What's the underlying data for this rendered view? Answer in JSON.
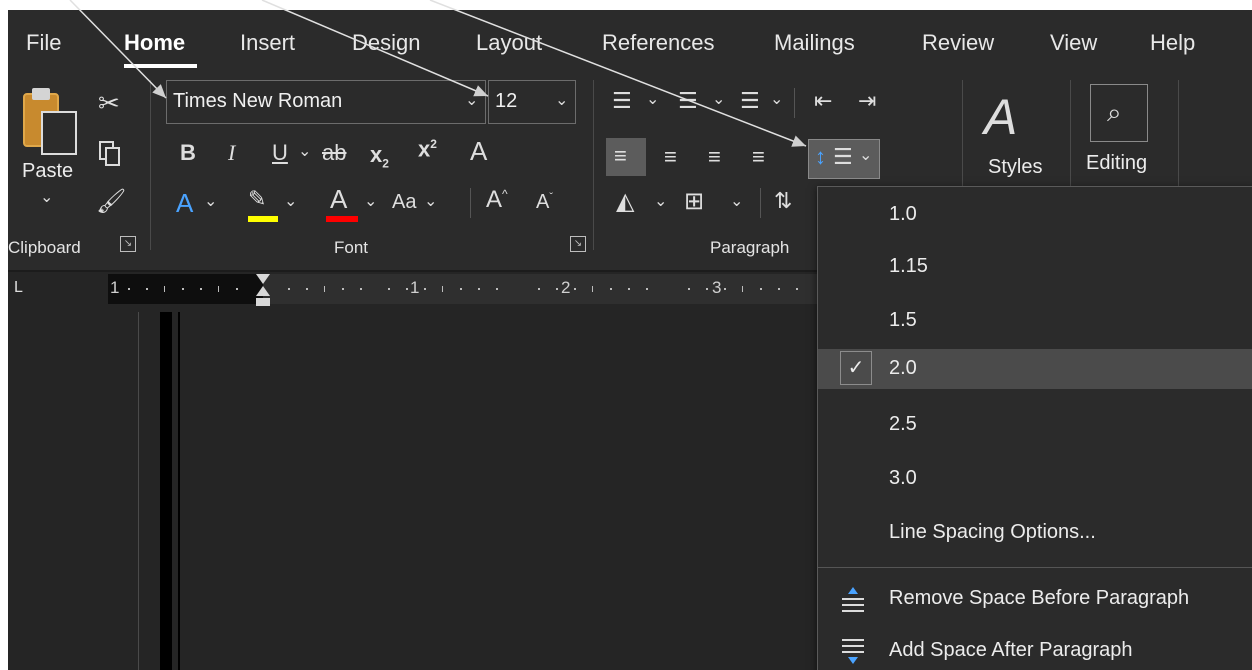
{
  "menu": {
    "tabs": [
      "File",
      "Home",
      "Insert",
      "Design",
      "Layout",
      "References",
      "Mailings",
      "Review",
      "View",
      "Help"
    ],
    "active": "Home"
  },
  "clipboard": {
    "paste_label": "Paste",
    "group_label": "Clipboard"
  },
  "font": {
    "name": "Times New Roman",
    "size": "12",
    "group_label": "Font",
    "change_case_label": "Aa",
    "highlight_color": "#ffff00",
    "font_color": "#ff0000"
  },
  "paragraph": {
    "group_label": "Paragraph"
  },
  "styles": {
    "label": "Styles"
  },
  "editing": {
    "label": "Editing"
  },
  "ruler": {
    "numbers": [
      "1",
      "1",
      "2",
      "3"
    ]
  },
  "line_spacing_menu": {
    "options": [
      "1.0",
      "1.15",
      "1.5",
      "2.0",
      "2.5",
      "3.0"
    ],
    "selected": "2.0",
    "more_options": "Line Spacing Options...",
    "remove_space": "Remove Space Before Paragraph",
    "add_space": "Add Space After Paragraph"
  },
  "colors": {
    "ribbon_bg": "#2b2b2b",
    "menu_selected_bg": "#4b4b4b",
    "accent_blue": "#1e90ff"
  }
}
